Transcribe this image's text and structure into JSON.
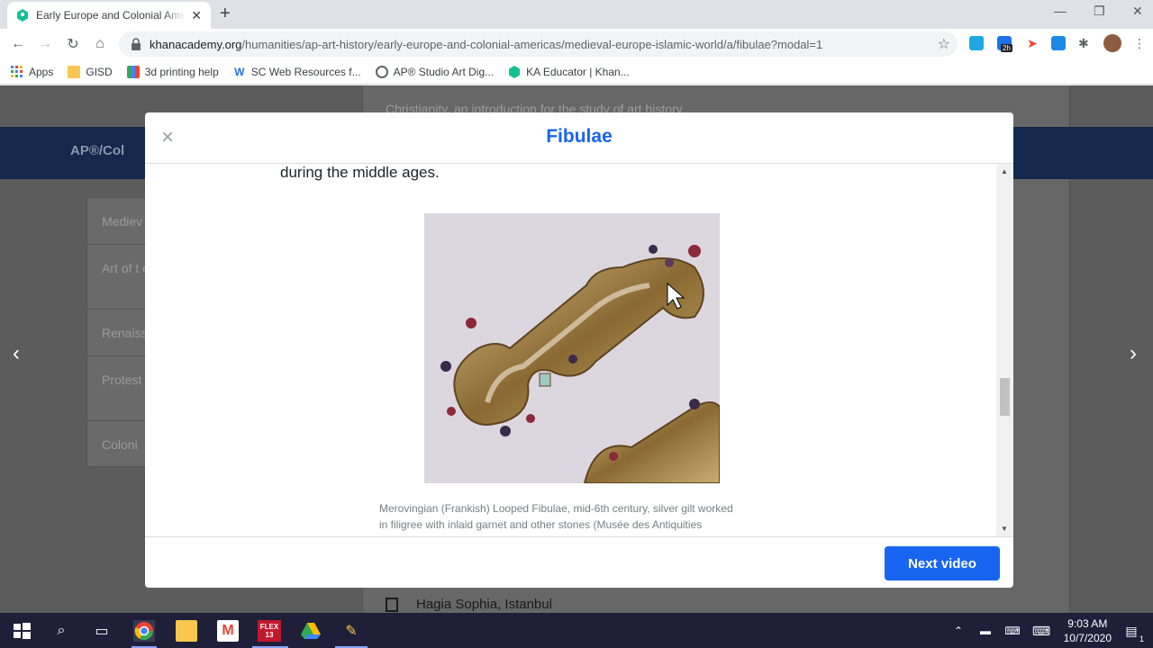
{
  "browser": {
    "tab_title": "Early Europe and Colonial Americas",
    "new_tab": "+",
    "url_host": "khanacademy.org",
    "url_path": "/humanities/ap-art-history/early-europe-and-colonial-americas/medieval-europe-islamic-world/a/fibulae?modal=1",
    "bookmarks": [
      {
        "label": "Apps",
        "icon": "apps-grid-icon",
        "color": "#4285f4"
      },
      {
        "label": "GISD",
        "icon": "folder-icon",
        "color": "#f9c74f"
      },
      {
        "label": "3d printing help",
        "icon": "bookmark-icon",
        "color": "#34a853"
      },
      {
        "label": "SC Web Resources f...",
        "icon": "w-logo-icon",
        "color": "#1a73e8"
      },
      {
        "label": "AP® Studio Art Dig...",
        "icon": "globe-icon",
        "color": "#5f6368"
      },
      {
        "label": "KA Educator | Khan...",
        "icon": "khan-icon",
        "color": "#14bf96"
      }
    ],
    "extensions_badge": "2h"
  },
  "page": {
    "band_text": "AP®/Col",
    "left_items": [
      "Mediev",
      "Art of t era",
      "Renaiss",
      "Protest Counte",
      "Coloni"
    ],
    "top_item": "Christianity, an introduction for the study of art history",
    "bottom_item": "Hagia Sophia, Istanbul"
  },
  "modal": {
    "title": "Fibulae",
    "close_symbol": "×",
    "lead_text": "during the middle ages.",
    "caption_line1": "Merovingian (Frankish) Looped Fibulae, mid-6th century, silver gilt worked",
    "caption_line2": "in filigree with inlaid garnet and other stones (Musée des Antiquities",
    "next_label": "Next video",
    "accent": "#1865f2"
  },
  "taskbar": {
    "time": "9:03 AM",
    "date": "10/7/2020",
    "flex_label": "FLEX",
    "flex_num": "13",
    "notif_count": "1"
  }
}
